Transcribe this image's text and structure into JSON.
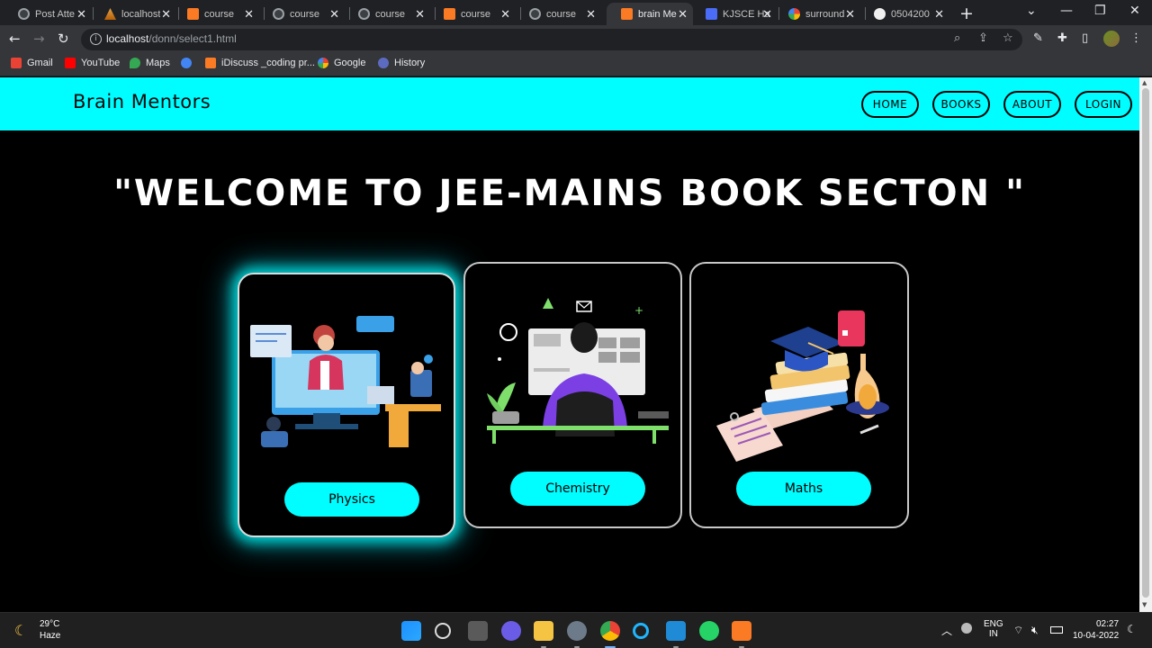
{
  "browser": {
    "tabs": [
      {
        "title": "Post Atte",
        "icon": "globe-icon"
      },
      {
        "title": "localhost",
        "icon": "lamp-icon"
      },
      {
        "title": "course",
        "icon": "xampp-icon"
      },
      {
        "title": "course",
        "icon": "globe-icon"
      },
      {
        "title": "course",
        "icon": "globe-icon"
      },
      {
        "title": "course",
        "icon": "xampp-icon"
      },
      {
        "title": "course",
        "icon": "globe-icon"
      },
      {
        "title": "brain Me",
        "icon": "xampp-icon",
        "active": true
      },
      {
        "title": "KJSCE Ha",
        "icon": "docs-icon"
      },
      {
        "title": "surround",
        "icon": "google-icon"
      },
      {
        "title": "0504200",
        "icon": "github-icon"
      }
    ],
    "url_host": "localhost",
    "url_path": "/donn/select1.html",
    "bookmarks": [
      {
        "label": "Gmail",
        "color": "#ea4335"
      },
      {
        "label": "YouTube",
        "color": "#ff0000"
      },
      {
        "label": "Maps",
        "color": "#34a853"
      },
      {
        "label": "",
        "color": "#4285f4"
      },
      {
        "label": "iDiscuss _coding pr...",
        "color": "#fb7a24"
      },
      {
        "label": "Google",
        "color": "#4285f4"
      },
      {
        "label": "History",
        "color": "#5c6bc0"
      }
    ]
  },
  "site": {
    "brand": "Brain Mentors",
    "nav": [
      "HOME",
      "BOOKS",
      "ABOUT",
      "LOGIN"
    ],
    "heading": "\"WELCOME TO JEE-MAINS BOOK SECTON \"",
    "accent": "#00fdff",
    "cards": [
      {
        "label": "Physics",
        "illustration": "teacher-online-class-illustration"
      },
      {
        "label": "Chemistry",
        "illustration": "student-at-computer-illustration"
      },
      {
        "label": "Maths",
        "illustration": "books-graduation-cap-illustration"
      }
    ]
  },
  "taskbar": {
    "temperature": "29°C",
    "weather": "Haze",
    "lang_top": "ENG",
    "lang_bottom": "IN",
    "time": "02:27",
    "date": "10-04-2022"
  }
}
